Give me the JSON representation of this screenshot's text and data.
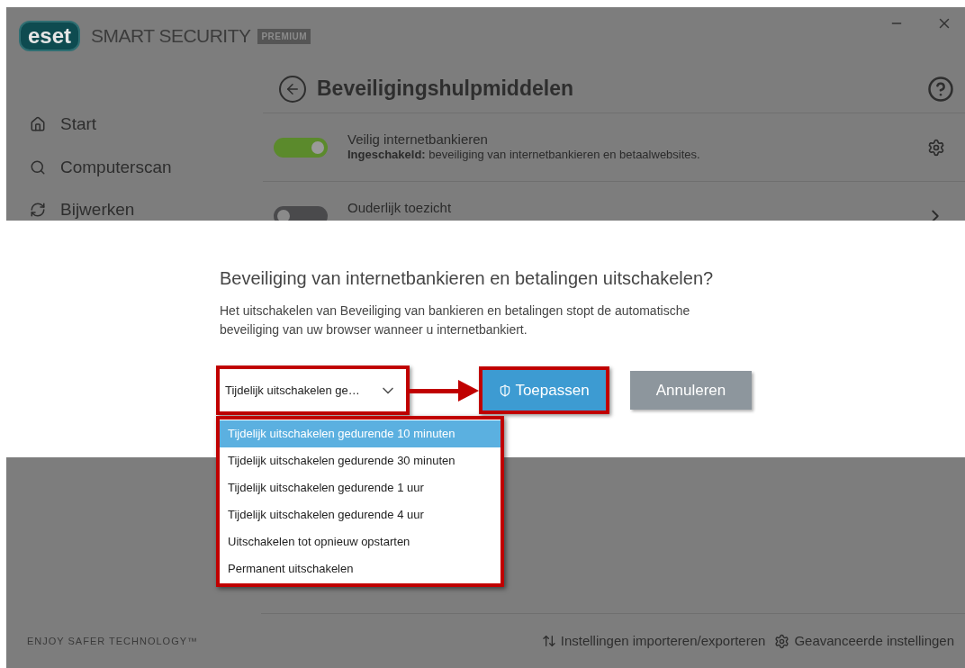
{
  "window": {
    "logo": "eset",
    "product": "SMART SECURITY",
    "edition": "PREMIUM"
  },
  "sidebar": {
    "items": [
      {
        "label": "Start",
        "kind": "home"
      },
      {
        "label": "Computerscan",
        "kind": "scan"
      },
      {
        "label": "Bijwerken",
        "kind": "update"
      }
    ]
  },
  "page": {
    "title": "Beveiligingshulpmiddelen"
  },
  "tools": [
    {
      "name": "Veilig internetbankieren",
      "description": "**Ingeschakeld:** beveiliging van internetbankieren en betaalwebsites.",
      "on": true,
      "kind": "settings"
    },
    {
      "name": "Ouderlijk toezicht",
      "on": false,
      "kind": "open"
    }
  ],
  "dialog": {
    "title": "Beveiliging van internetbankieren en betalingen uitschakelen?",
    "message": "Het uitschakelen van Beveiliging van bankieren en betalingen stopt de automatische beveiliging van uw browser wanneer u internetbankiert.",
    "select": {
      "value": "Tijdelijk uitschakelen ge…",
      "expanded": true,
      "options": [
        {
          "label": "Tijdelijk uitschakelen gedurende 10 minuten",
          "selected": true
        },
        {
          "label": "Tijdelijk uitschakelen gedurende 30 minuten",
          "selected": false
        },
        {
          "label": "Tijdelijk uitschakelen gedurende 1 uur",
          "selected": false
        },
        {
          "label": "Tijdelijk uitschakelen gedurende 4 uur",
          "selected": false
        },
        {
          "label": "Uitschakelen tot opnieuw opstarten",
          "selected": false
        },
        {
          "label": "Permanent uitschakelen",
          "selected": false
        }
      ]
    },
    "buttons": [
      {
        "label": "Toepassen",
        "kind": "primary"
      },
      {
        "label": "Annuleren",
        "kind": "secondary"
      }
    ]
  },
  "footer": {
    "tagline": "ENJOY SAFER TECHNOLOGY™",
    "links": [
      {
        "label": "Instellingen importeren/exporteren",
        "kind": "import"
      },
      {
        "label": "Geavanceerde instellingen",
        "kind": "advanced"
      }
    ]
  }
}
